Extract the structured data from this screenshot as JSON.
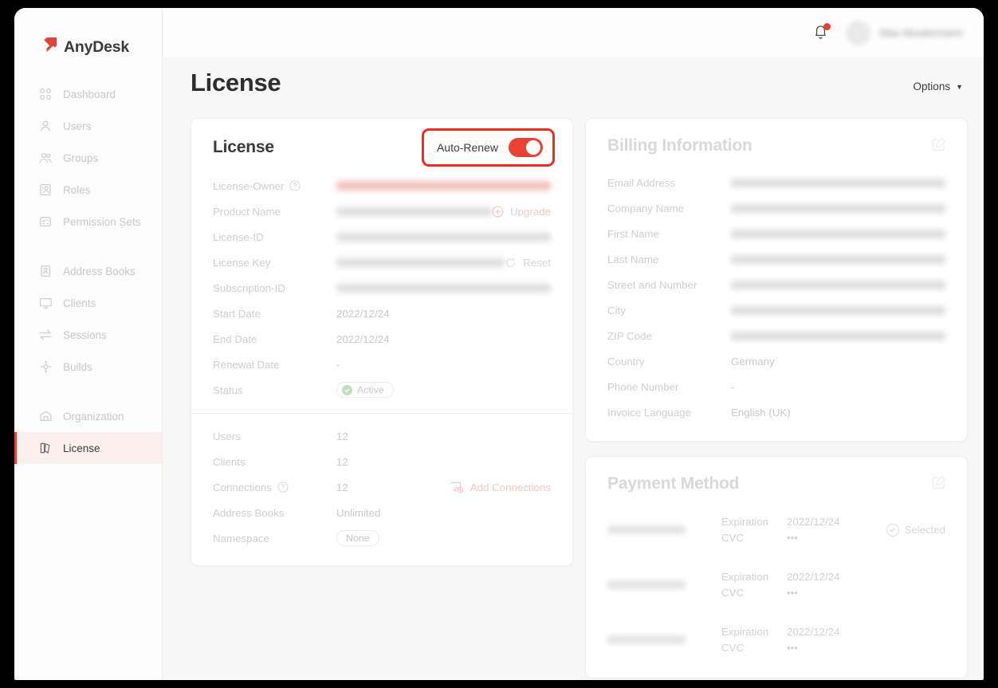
{
  "brand": {
    "name": "AnyDesk"
  },
  "sidebar": {
    "items": [
      {
        "label": "Dashboard",
        "icon": "dashboard-icon",
        "active": false
      },
      {
        "label": "Users",
        "icon": "user-icon",
        "active": false
      },
      {
        "label": "Groups",
        "icon": "users-group-icon",
        "active": false
      },
      {
        "label": "Roles",
        "icon": "roles-icon",
        "active": false
      },
      {
        "label": "Permission Sets",
        "icon": "permission-sets-icon",
        "active": false
      },
      {
        "label": "Address Books",
        "icon": "address-book-icon",
        "active": false
      },
      {
        "label": "Clients",
        "icon": "monitor-icon",
        "active": false
      },
      {
        "label": "Sessions",
        "icon": "sessions-arrows-icon",
        "active": false
      },
      {
        "label": "Builds",
        "icon": "builds-icon",
        "active": false
      },
      {
        "label": "Organization",
        "icon": "organization-icon",
        "active": false
      },
      {
        "label": "License",
        "icon": "license-book-icon",
        "active": true
      }
    ]
  },
  "topbar": {
    "notification_icon": "bell-icon",
    "has_notification": true,
    "user_name": "Max Mustermann"
  },
  "header": {
    "title": "License",
    "options_label": "Options",
    "options_caret": "▼"
  },
  "license_card": {
    "title": "License",
    "auto_renew": {
      "label": "Auto-Renew",
      "enabled": true,
      "highlighted": true,
      "highlight_color": "#ef2d20"
    },
    "rows": [
      {
        "label": "License-Owner",
        "help": true,
        "value": "",
        "redacted": true,
        "redact_width": 290,
        "redact_tint": "owner"
      },
      {
        "label": "Product Name",
        "help": false,
        "value": "",
        "redacted": true,
        "redact_width": 94,
        "action": "Upgrade",
        "action_icon": "plus-circle-icon"
      },
      {
        "label": "License-ID",
        "help": false,
        "value": "",
        "redacted": true,
        "redact_width": 116
      },
      {
        "label": "License Key",
        "help": false,
        "value": "",
        "redacted": true,
        "redact_width": 130,
        "action": "Reset",
        "action_icon": "refresh-icon"
      },
      {
        "label": "Subscription-ID",
        "help": false,
        "value": "",
        "redacted": true,
        "redact_width": 88
      },
      {
        "label": "Start Date",
        "help": false,
        "value": "2022/12/24",
        "redacted": false
      },
      {
        "label": "End Date",
        "help": false,
        "value": "2022/12/24",
        "redacted": false
      },
      {
        "label": "Renewal Date",
        "help": false,
        "value": "-",
        "redacted": false
      },
      {
        "label": "Status",
        "help": false,
        "value": "Active",
        "redacted": false,
        "badge": "status"
      }
    ],
    "rows2": [
      {
        "label": "Users",
        "help": false,
        "value": "12",
        "redacted": false
      },
      {
        "label": "Clients",
        "help": false,
        "value": "12",
        "redacted": false
      },
      {
        "label": "Connections",
        "help": true,
        "value": "12",
        "redacted": false,
        "action": "Add Connections",
        "action_icon": "add-connections-icon"
      },
      {
        "label": "Address Books",
        "help": false,
        "value": "Unlimited",
        "redacted": false
      },
      {
        "label": "Namespace",
        "help": false,
        "value": "None",
        "redacted": false,
        "badge": "plain"
      }
    ]
  },
  "billing_card": {
    "title": "Billing Information",
    "edit_icon": "edit-pencil-icon",
    "rows": [
      {
        "label": "Email Address",
        "value": "",
        "redacted": true,
        "redact_width": 158
      },
      {
        "label": "Company Name",
        "value": "",
        "redacted": true,
        "redact_width": 130
      },
      {
        "label": "First Name",
        "value": "",
        "redacted": true,
        "redact_width": 64
      },
      {
        "label": "Last Name",
        "value": "",
        "redacted": true,
        "redact_width": 72
      },
      {
        "label": "Street and Number",
        "value": "",
        "redacted": true,
        "redact_width": 82
      },
      {
        "label": "City",
        "value": "",
        "redacted": true,
        "redact_width": 52
      },
      {
        "label": "ZIP Code",
        "value": "",
        "redacted": true,
        "redact_width": 28
      },
      {
        "label": "Country",
        "value": "Germany",
        "redacted": false
      },
      {
        "label": "Phone Number",
        "value": "-",
        "redacted": false
      },
      {
        "label": "Invoice Language",
        "value": "English (UK)",
        "redacted": false
      }
    ]
  },
  "payment_card": {
    "title": "Payment Method",
    "edit_icon": "edit-pencil-icon",
    "expiration_label": "Expiration",
    "cvc_label": "CVC",
    "cvc_value": "•••",
    "selected_label": "Selected",
    "methods": [
      {
        "card": "",
        "redacted": true,
        "expiration": "2022/12/24",
        "cvc": "•••",
        "selected": true
      },
      {
        "card": "",
        "redacted": true,
        "expiration": "2022/12/24",
        "cvc": "•••",
        "selected": false
      },
      {
        "card": "",
        "redacted": true,
        "expiration": "2022/12/24",
        "cvc": "•••",
        "selected": false
      }
    ]
  },
  "colors": {
    "brand_red": "#e0453a",
    "highlight_red": "#ef2d20",
    "toggle_on": "#eb4034",
    "status_green": "#7fc07a",
    "page_bg": "#f7f7f7",
    "sidebar_active_bg": "#fcf0ee"
  }
}
